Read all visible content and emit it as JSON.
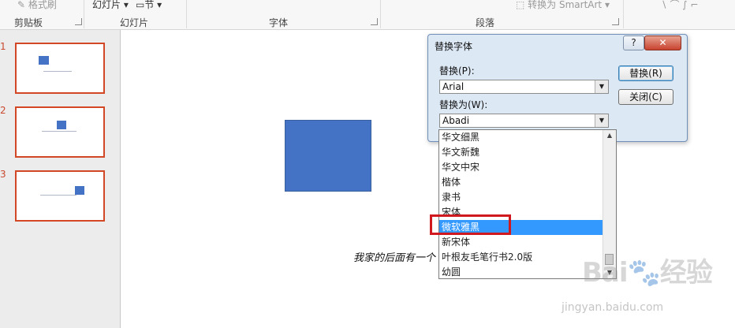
{
  "ribbon": {
    "format_painter": "格式刷",
    "slides_button": "幻灯片",
    "section_button": "节",
    "convert_smartart": "转换为 SmartArt",
    "groups": {
      "clipboard": "剪贴板",
      "slides": "幻灯片",
      "font": "字体",
      "paragraph": "段落"
    }
  },
  "slides": [
    {
      "number": "1"
    },
    {
      "number": "2"
    },
    {
      "number": "3"
    }
  ],
  "slide": {
    "caption": "我家的后面有一个"
  },
  "dialog": {
    "title": "替换字体",
    "help": "?",
    "close": "✕",
    "replace_label": "替换(P):",
    "replace_value": "Arial",
    "with_label": "替换为(W):",
    "with_value": "Abadi",
    "replace_button": "替换(R)",
    "close_button": "关闭(C)"
  },
  "font_list": {
    "items": [
      "华文细黑",
      "华文新魏",
      "华文中宋",
      "楷体",
      "隶书",
      "宋体",
      "微软雅黑",
      "新宋体",
      "叶根友毛笔行书2.0版",
      "幼圆"
    ],
    "selected": "微软雅黑"
  },
  "watermark": {
    "logo": "Bai🐾经验",
    "url": "jingyan.baidu.com"
  },
  "colors": {
    "accent_orange": "#d24726",
    "shape_blue": "#4472c4",
    "selection_blue": "#3399ff",
    "annotation_red": "#d0191f"
  }
}
